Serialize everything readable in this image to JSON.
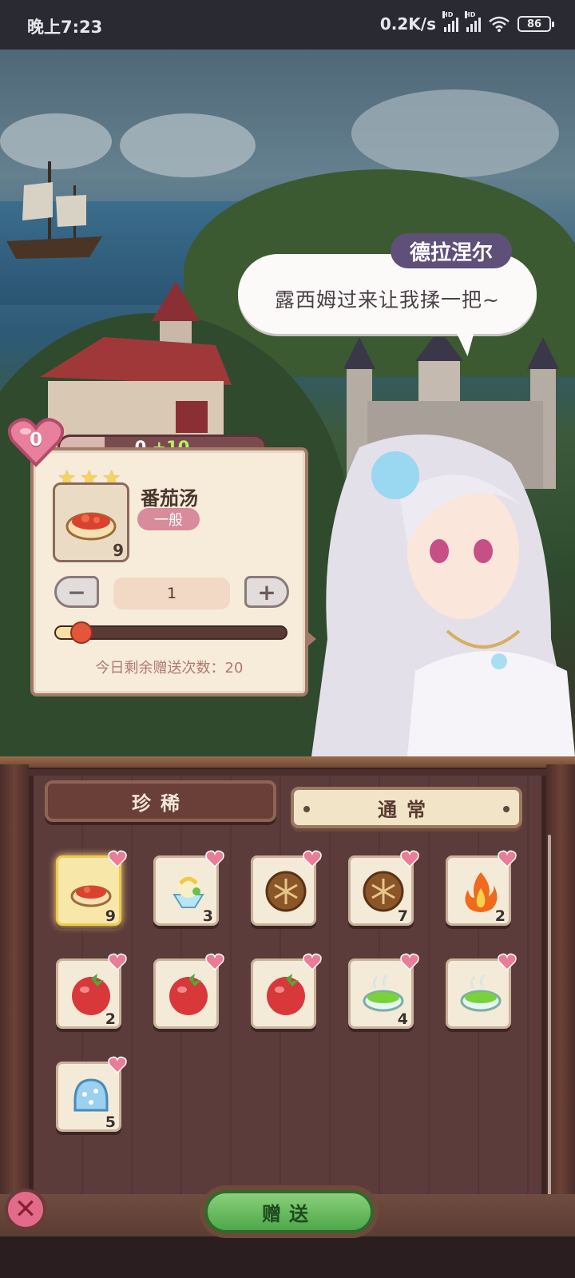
{
  "status_bar": {
    "time": "晚上7:23",
    "network_speed": "0.2K/s",
    "signal_label": "HD",
    "battery": "86"
  },
  "dialogue": {
    "speaker": "德拉涅尔",
    "text": "露西姆过来让我揉一把~"
  },
  "affection": {
    "level": "0",
    "current": "0",
    "gain": "+10",
    "progress_fraction": 0.22
  },
  "gift_panel": {
    "stars": 3,
    "item_name": "番茄汤",
    "rarity": "一般",
    "item_count": "9",
    "quantity": "1",
    "quantity_fraction": 0.11,
    "remaining_label": "今日剩余赠送次数：20"
  },
  "inventory": {
    "tabs": [
      {
        "label": "珍稀",
        "active": false
      },
      {
        "label": "通常",
        "active": true
      }
    ],
    "items": [
      {
        "icon": "tomato-soup-icon",
        "count": "9",
        "selected": true
      },
      {
        "icon": "shaved-ice-icon",
        "count": "3",
        "selected": false
      },
      {
        "icon": "bread-icon",
        "count": "",
        "selected": false
      },
      {
        "icon": "bread-icon",
        "count": "7",
        "selected": false
      },
      {
        "icon": "fire-icon",
        "count": "2",
        "selected": false
      },
      {
        "icon": "tomato-icon",
        "count": "2",
        "selected": false
      },
      {
        "icon": "tomato-icon",
        "count": "",
        "selected": false
      },
      {
        "icon": "tomato-icon",
        "count": "",
        "selected": false
      },
      {
        "icon": "green-soup-icon",
        "count": "4",
        "selected": false
      },
      {
        "icon": "green-soup-icon",
        "count": "",
        "selected": false
      },
      {
        "icon": "ice-crystal-icon",
        "count": "5",
        "selected": false
      }
    ]
  },
  "actions": {
    "send_label": "赠送",
    "close_symbol": "✕"
  },
  "colors": {
    "affection_gain": "#b9f06b",
    "rarity_badge": "#d88b9a",
    "send_button": "#4ea84a",
    "speaker_tag": "#5e5079"
  }
}
